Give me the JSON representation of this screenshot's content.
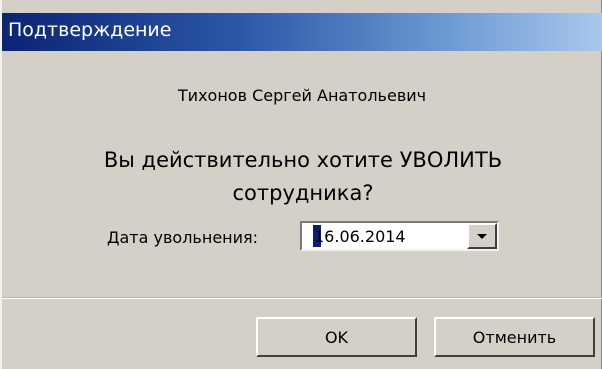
{
  "dialog": {
    "title": "Подтверждение",
    "employee_name": "Тихонов Сергей Анатольевич",
    "question": "Вы действительно хотите УВОЛИТЬ сотрудника?",
    "date_label": "Дата увольнения:",
    "date_value": "16.06.2014",
    "ok_label": "OK",
    "cancel_label": "Отменить"
  },
  "colors": {
    "titlebar_start": "#0b2473",
    "titlebar_end": "#a9c7ec",
    "dialog_background": "#d4d0c8",
    "caret": "#0a1e7a"
  },
  "icons": {
    "dropdown": "chevron-down-icon"
  }
}
